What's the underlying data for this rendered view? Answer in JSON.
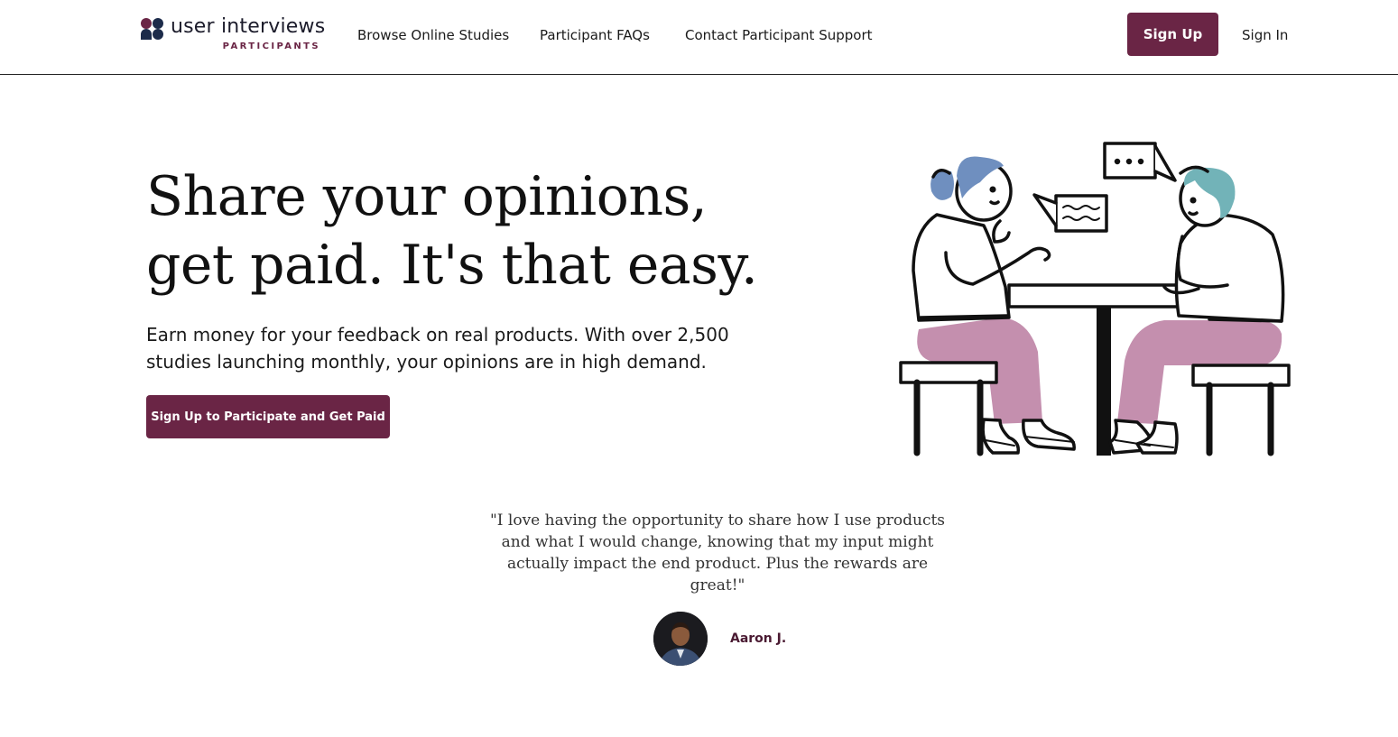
{
  "header": {
    "logo_text": "user interviews",
    "logo_sub": "PARTICIPANTS",
    "nav": [
      {
        "label": "Browse Online Studies"
      },
      {
        "label": "Participant FAQs"
      },
      {
        "label": "Contact Participant Support"
      }
    ],
    "signup_label": "Sign Up",
    "signin_label": "Sign In"
  },
  "hero": {
    "title_line1": "Share your opinions,",
    "title_line2": "get paid. It's that easy.",
    "subtitle_line1": "Earn money for your feedback on real products. With over 2,500",
    "subtitle_line2": "studies launching monthly, your opinions are in high demand.",
    "cta_label": "Sign Up to Participate and Get Paid"
  },
  "testimonial": {
    "quote": "\"I love having the opportunity to share how I use products and what I would change, knowing that my input might actually impact the end product. Plus the rewards are great!\"",
    "author": "Aaron J."
  },
  "colors": {
    "brand": "#6a2545",
    "hair_blue": "#6f8fbf",
    "hair_teal": "#72b3b8",
    "pants": "#c48fae"
  }
}
